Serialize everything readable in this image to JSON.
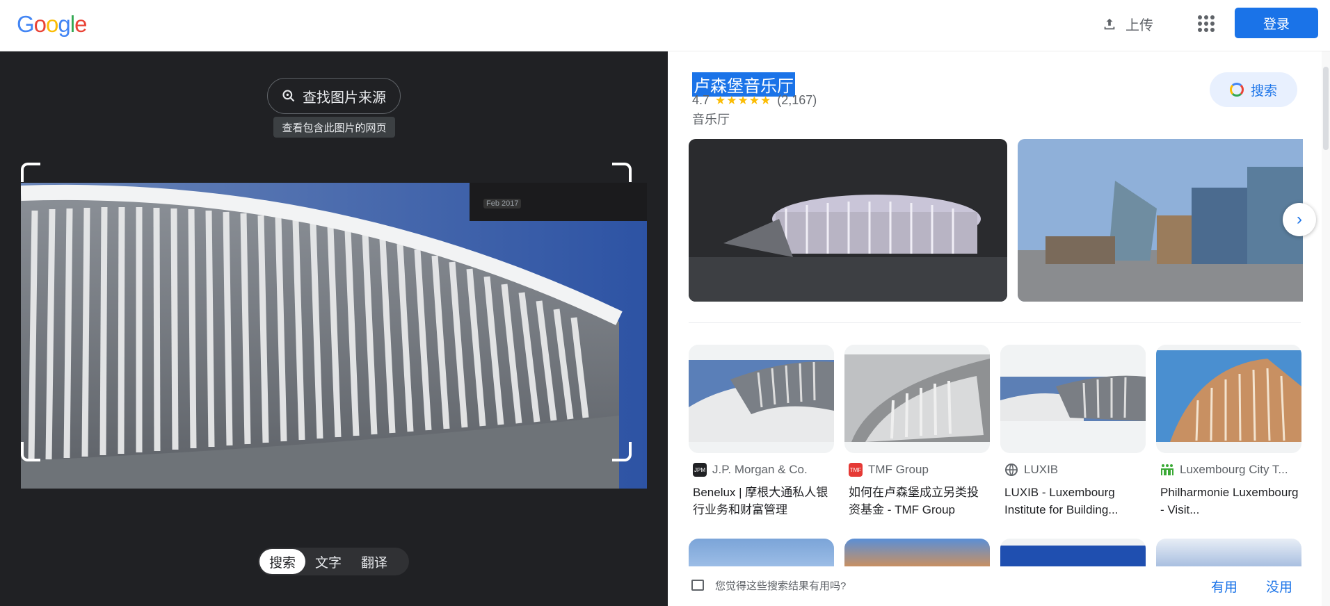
{
  "header": {
    "logo": "Google",
    "upload_label": "上传",
    "login_label": "登录"
  },
  "left": {
    "find_source_label": "查找图片来源",
    "tooltip": "查看包含此图片的网页",
    "photo_date": "Feb 2017",
    "modes": [
      "搜索",
      "文字",
      "翻译"
    ],
    "active_mode": "搜索"
  },
  "result": {
    "title": "卢森堡音乐厅",
    "rating": "4.7",
    "stars": "★★★★★",
    "review_count": "(2,167)",
    "category": "音乐厅",
    "search_label": "搜索"
  },
  "cards": [
    {
      "source": "J.P. Morgan & Co.",
      "icon": "JPM",
      "icon_color": "#202124",
      "desc": "Benelux | 摩根大通私人银行业务和财富管理"
    },
    {
      "source": "TMF Group",
      "icon": "TMF",
      "icon_color": "#e53935",
      "desc": "如何在卢森堡成立另类投资基金 - TMF Group"
    },
    {
      "source": "LUXIB",
      "icon": "globe-icon",
      "icon_color": "#5f6368",
      "desc": "LUXIB - Luxembourg Institute for Building..."
    },
    {
      "source": "Luxembourg City T...",
      "icon": "people-icon",
      "icon_color": "#3aa935",
      "desc": "Philharmonie Luxembourg - Visit..."
    }
  ],
  "feedback": {
    "question": "您觉得这些搜索结果有用吗?",
    "yes": "有用",
    "no": "没用"
  }
}
